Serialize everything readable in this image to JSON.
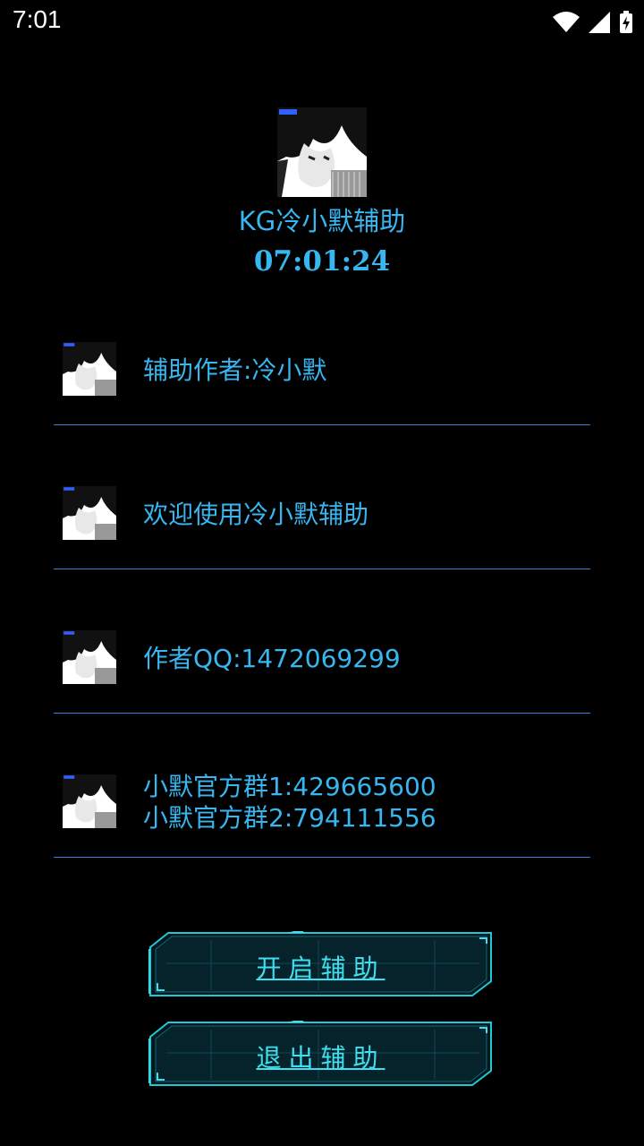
{
  "status_bar": {
    "time": "7:01"
  },
  "header": {
    "title": "KG冷小默辅助",
    "clock": "07:01:24"
  },
  "rows": [
    {
      "lines": [
        "辅助作者:冷小默"
      ]
    },
    {
      "lines": [
        "欢迎使用冷小默辅助"
      ]
    },
    {
      "lines": [
        "作者QQ:1472069299"
      ]
    },
    {
      "lines": [
        "小默官方群1:429665600",
        "小默官方群2:794111556"
      ]
    }
  ],
  "buttons": {
    "start_label": "开启辅助",
    "exit_label": "退出辅助"
  },
  "colors": {
    "accent": "#37b6f0",
    "divider": "#3a7fd0",
    "button_glow": "#3ee0f0"
  }
}
